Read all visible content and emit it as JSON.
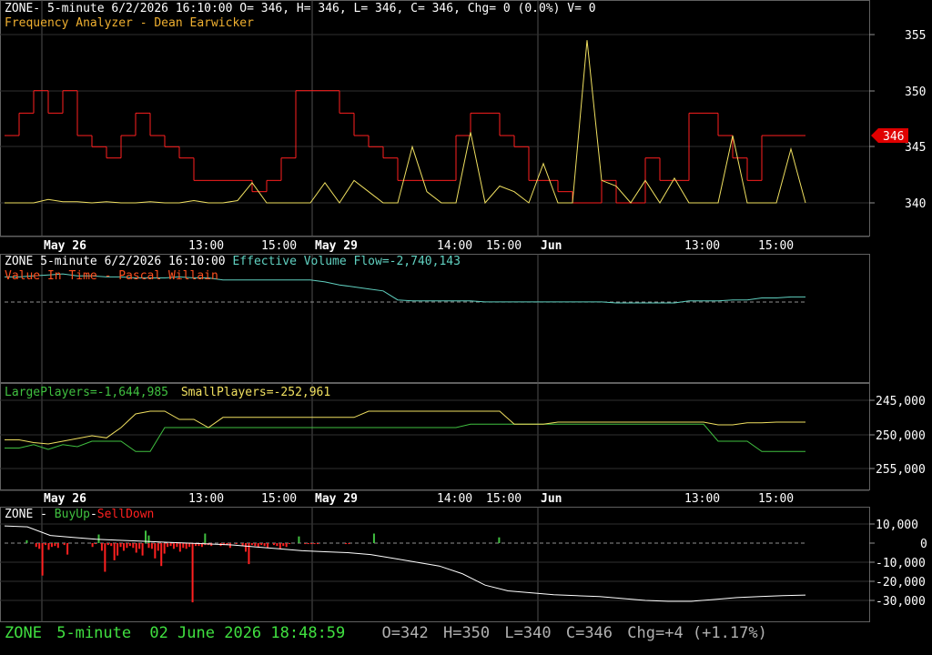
{
  "panel1": {
    "line1": "ZONE- 5-minute 6/2/2026 16:10:00 O= 346, H= 346, L= 346, C= 346, Chg= 0 (0.0%) V= 0",
    "line2": "Frequency Analyzer - Dean Earwicker",
    "last_price_tag": "346"
  },
  "panel2": {
    "line1_a": "ZONE 5-minute  6/2/2026 16:10:00",
    "line1_b": "Effective Volume Flow=-2,740,143",
    "line2": "Value In Time - Pascal Willain"
  },
  "panel3": {
    "large": "LargePlayers=-1,644,985",
    "small": "SmallPlayers=-252,961"
  },
  "panel4": {
    "title_a": "ZONE - ",
    "title_b": "BuyUp",
    "title_c": "-",
    "title_d": "SellDown"
  },
  "status": {
    "symbol": "ZONE",
    "interval": "5-minute",
    "datetime": "02 June 2026 18:48:59",
    "o": "O=342",
    "h": "H=350",
    "l": "L=340",
    "c": "C=346",
    "chg": "Chg=+4 (+1.17%)"
  },
  "chart_data": [
    {
      "type": "line",
      "title": "Frequency Analyzer - Dean Earwicker",
      "x_tick_labels": [
        "May 26",
        "13:00",
        "15:00",
        "May 29",
        "14:00",
        "15:00",
        "Jun",
        "13:00",
        "15:00"
      ],
      "y_tick_labels": [
        "355",
        "350",
        "345",
        "340"
      ],
      "ylim": [
        337.5,
        357.5
      ],
      "last_value": 346,
      "series": [
        {
          "name": "price",
          "color": "#ff2020",
          "values": [
            346,
            348,
            350,
            348,
            350,
            346,
            345,
            344,
            346,
            348,
            346,
            345,
            344,
            342,
            342,
            342,
            342,
            341,
            342,
            344,
            350,
            350,
            350,
            348,
            346,
            345,
            344,
            342,
            342,
            342,
            342,
            346,
            348,
            348,
            346,
            345,
            342,
            342,
            341,
            340,
            340,
            342,
            340,
            340,
            344,
            342,
            342,
            348,
            348,
            346,
            344,
            342,
            346,
            346,
            346,
            346
          ]
        },
        {
          "name": "frequency",
          "color": "#f0e060",
          "values": [
            340,
            340,
            340,
            340.3,
            340.1,
            340.1,
            340,
            340.1,
            340,
            340,
            340.1,
            340,
            340,
            340.2,
            340,
            340,
            340.2,
            341.8,
            340,
            340,
            340,
            340,
            341.8,
            340,
            342,
            341,
            340,
            340,
            345,
            341,
            340,
            340,
            346.3,
            340,
            341.5,
            341,
            340,
            343.5,
            340,
            340,
            354.5,
            342,
            341.5,
            340,
            342,
            340,
            342.2,
            340,
            340,
            340,
            346,
            340,
            340,
            340,
            344.8,
            340
          ]
        }
      ]
    },
    {
      "type": "line",
      "title": "Effective Volume Flow",
      "series": [
        {
          "name": "Effective Volume Flow",
          "color": "#60d0c0",
          "values": [
            0.96,
            0.96,
            0.97,
            0.98,
            0.99,
            0.97,
            0.97,
            0.96,
            0.96,
            0.95,
            0.95,
            0.95,
            0.96,
            0.95,
            0.95,
            0.93,
            0.93,
            0.93,
            0.93,
            0.93,
            0.93,
            0.93,
            0.91,
            0.88,
            0.86,
            0.84,
            0.82,
            0.73,
            0.72,
            0.72,
            0.72,
            0.72,
            0.72,
            0.71,
            0.71,
            0.71,
            0.71,
            0.71,
            0.71,
            0.71,
            0.71,
            0.71,
            0.7,
            0.7,
            0.7,
            0.7,
            0.7,
            0.72,
            0.72,
            0.72,
            0.73,
            0.73,
            0.75,
            0.75,
            0.76,
            0.76
          ]
        }
      ]
    },
    {
      "type": "line",
      "title": "LargePlayers / SmallPlayers",
      "y_tick_labels": [
        "245,000",
        "250,000",
        "255,000"
      ],
      "series": [
        {
          "name": "LargePlayers",
          "color": "#40c040",
          "values": [
            252.0,
            252.0,
            251.5,
            252.2,
            251.5,
            251.8,
            251.0,
            251.0,
            251.0,
            252.5,
            252.5,
            249.0,
            249.0,
            249.0,
            249.0,
            249.0,
            249.0,
            249.0,
            249.0,
            249.0,
            249.0,
            249.0,
            249.0,
            249.0,
            249.0,
            249.0,
            249.0,
            249.0,
            249.0,
            249.0,
            249.0,
            249.0,
            248.5,
            248.5,
            248.5,
            248.5,
            248.5,
            248.5,
            248.5,
            248.5,
            248.5,
            248.5,
            248.5,
            248.5,
            248.5,
            248.5,
            248.5,
            248.5,
            248.5,
            251.0,
            251.0,
            251.0,
            252.5,
            252.5,
            252.5,
            252.5
          ]
        },
        {
          "name": "SmallPlayers",
          "color": "#f0e060",
          "values": [
            250.8,
            250.8,
            251.2,
            251.4,
            251.0,
            250.6,
            250.2,
            250.5,
            249.0,
            247.0,
            246.6,
            246.6,
            247.8,
            247.8,
            249.0,
            247.5,
            247.5,
            247.5,
            247.5,
            247.5,
            247.5,
            247.5,
            247.5,
            247.5,
            247.5,
            246.6,
            246.6,
            246.6,
            246.6,
            246.6,
            246.6,
            246.6,
            246.6,
            246.6,
            246.6,
            248.5,
            248.5,
            248.5,
            248.2,
            248.2,
            248.2,
            248.2,
            248.2,
            248.2,
            248.2,
            248.2,
            248.2,
            248.2,
            248.2,
            248.6,
            248.6,
            248.3,
            248.3,
            248.2,
            248.2,
            248.2
          ]
        }
      ]
    },
    {
      "type": "bar",
      "title": "BuyUp-SellDown",
      "y_tick_labels": [
        "10,000",
        "0",
        "-10,000",
        "-20,000",
        "-30,000"
      ],
      "ylim": [
        -35000,
        12000
      ],
      "series": [
        {
          "name": "BuyUp",
          "color": "#40c040",
          "values": [
            0,
            1500,
            0,
            0,
            0,
            0,
            0,
            0,
            0,
            0,
            300,
            0,
            0,
            0,
            0,
            0,
            0,
            0,
            0,
            0,
            0,
            0,
            0,
            0,
            4500,
            0,
            0,
            0,
            0,
            0,
            0,
            0,
            0,
            0,
            0,
            0,
            0,
            0,
            0,
            6500,
            4000,
            0,
            0,
            0,
            0,
            0,
            0,
            0,
            0,
            0,
            0,
            0,
            0,
            0,
            0,
            0,
            0,
            0,
            5000,
            0,
            0,
            0,
            0,
            0,
            0,
            0,
            0,
            0,
            0,
            0,
            0,
            0,
            0,
            0,
            0,
            0,
            0,
            0,
            0,
            0,
            0,
            0,
            0,
            0,
            0,
            0,
            0,
            0,
            3500,
            0,
            0,
            0,
            0,
            0,
            0,
            0,
            0,
            0,
            0,
            0,
            0,
            0,
            0,
            0,
            0,
            0,
            0,
            0,
            0,
            0,
            0,
            0,
            5000,
            0,
            0,
            0,
            0,
            0,
            0,
            0,
            0,
            0,
            0,
            0,
            0,
            0,
            0,
            0,
            0,
            0,
            0,
            0,
            0,
            0,
            0,
            0,
            0,
            0,
            0,
            0,
            0,
            0,
            0,
            0,
            0,
            0,
            0,
            0,
            0,
            0,
            0,
            0,
            3000,
            0,
            0,
            0,
            0,
            0
          ]
        },
        {
          "name": "SellDown",
          "color": "#ff2020",
          "values": [
            0,
            0,
            0,
            0,
            -2000,
            -3000,
            -17000,
            -1000,
            -3500,
            -2000,
            -1500,
            -2500,
            0,
            -1000,
            -6000,
            0,
            0,
            0,
            0,
            0,
            0,
            0,
            -2000,
            -500,
            0,
            -4000,
            -15000,
            -1000,
            -1500,
            -9000,
            -6500,
            -2000,
            -4000,
            -2500,
            -1500,
            -2500,
            -5000,
            -3000,
            -6500,
            0,
            -2500,
            -3000,
            -8000,
            -4000,
            -12000,
            -5500,
            -2000,
            -1500,
            -3000,
            -2000,
            -4500,
            -2500,
            -3000,
            -2000,
            -31000,
            -1500,
            -1500,
            -2000,
            -1000,
            -1000,
            -1500,
            0,
            0,
            -1500,
            -1000,
            -1000,
            -2500,
            0,
            -500,
            0,
            -1500,
            -4500,
            -11000,
            -1000,
            -1500,
            -2000,
            -1000,
            -1500,
            -2500,
            0,
            -1000,
            -1500,
            -3000,
            -1500,
            -2000,
            -500,
            0,
            0,
            0,
            0,
            -500,
            -500,
            -500,
            -500,
            -500,
            0,
            0,
            0,
            0,
            0,
            0,
            0,
            0,
            -500,
            -500,
            0,
            0,
            0,
            0,
            0,
            0,
            0,
            0,
            0,
            0,
            0,
            0,
            0,
            0,
            0,
            0,
            0,
            0,
            0,
            0,
            0,
            0,
            0,
            0,
            0,
            0,
            0,
            0,
            0,
            0,
            0,
            0,
            0,
            0,
            0,
            0,
            0,
            0,
            0,
            0,
            0,
            0,
            0,
            0,
            0,
            0,
            0,
            0,
            0,
            0,
            0,
            0,
            0,
            0,
            0,
            0,
            0,
            0,
            0,
            0,
            0,
            0,
            0,
            0,
            0,
            0,
            0,
            0,
            0,
            0
          ]
        },
        {
          "name": "cumulative",
          "color": "#ffffff",
          "values": [
            9000,
            8500,
            4000,
            3000,
            2000,
            1500,
            1000,
            500,
            0,
            -500,
            -1000,
            -2000,
            -3000,
            -4000,
            -4500,
            -5000,
            -6000,
            -8000,
            -10000,
            -12000,
            -16000,
            -22000,
            -25000,
            -26000,
            -27000,
            -27500,
            -28000,
            -29000,
            -30000,
            -30500,
            -30500,
            -29500,
            -28500,
            -28000,
            -27500,
            -27200
          ]
        }
      ]
    }
  ]
}
